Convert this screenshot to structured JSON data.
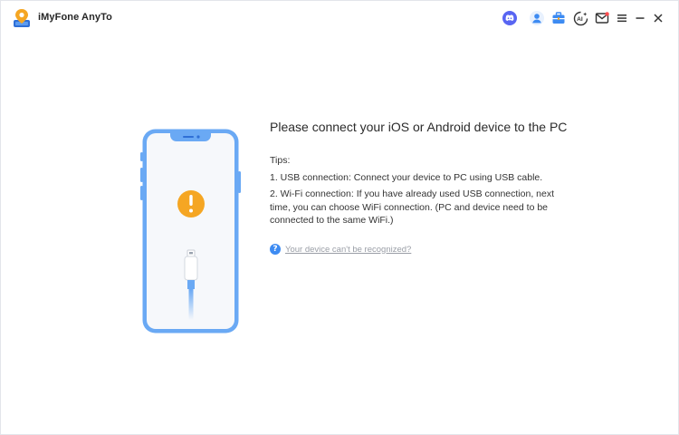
{
  "app": {
    "title": "iMyFone AnyTo",
    "logo_icon": "location-pin-logo-icon"
  },
  "titlebar": {
    "icons": [
      {
        "name": "discord-icon",
        "color": "#5865f2"
      },
      {
        "name": "user-account-icon",
        "color": "#3d8bf2"
      },
      {
        "name": "toolbox-icon",
        "color": "#3d8bf2"
      },
      {
        "name": "ai-icon",
        "color": "#333333"
      },
      {
        "name": "mail-icon",
        "color": "#333333"
      },
      {
        "name": "menu-icon",
        "color": "#333333"
      },
      {
        "name": "minimize-icon",
        "color": "#333333"
      },
      {
        "name": "close-icon",
        "color": "#333333"
      }
    ]
  },
  "main": {
    "headline": "Please connect your iOS or Android device to the PC",
    "tips_title": "Tips:",
    "tips": [
      "1. USB connection: Connect your device to PC using USB cable.",
      "2. Wi-Fi connection: If you have already used USB connection, next time, you can choose WiFi connection. (PC and device need to be connected to the same WiFi.)"
    ],
    "help_icon_glyph": "?",
    "help_link": "Your device can't be recognized?"
  },
  "colors": {
    "accent": "#3d8bf2",
    "phone_frame": "#6aa9f4",
    "warning": "#f5a623",
    "text": "#2b2b2b",
    "link": "#9a9ea6"
  }
}
